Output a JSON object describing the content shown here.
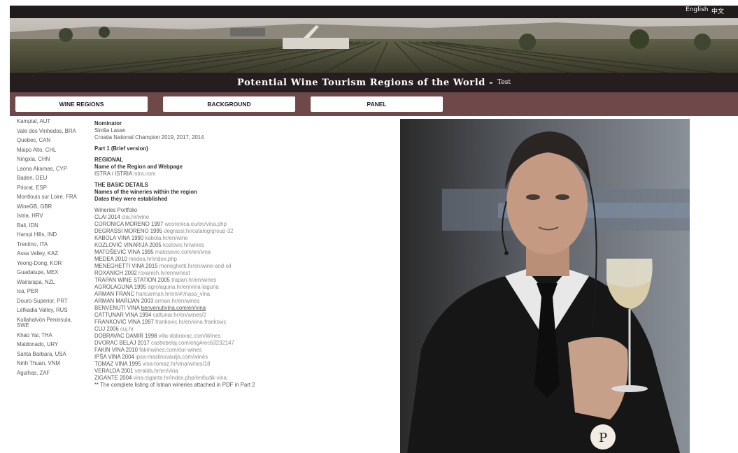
{
  "header": {
    "lang_english": "English",
    "lang_chinese": "中文",
    "title": "Potential Wine Tourism Regions of the World -",
    "subtitle": "Test"
  },
  "nav": {
    "wine_regions": "WINE REGIONS",
    "background": "BACKGROUND",
    "panel": "PANEL"
  },
  "sidebar": {
    "items": [
      "Kamptal, AUT",
      "Vale dos Vinhedos, BRA",
      "Quebec, CAN",
      "Maipo Alto, CHL",
      "Ningxia, CHN",
      "Laona Akamas, CYP",
      "Baden, DEU",
      "Priorat, ESP",
      "Montlouis sur Loire, FRA",
      "WineGB, GBR",
      "Istria, HRV",
      "Bali, IDN",
      "Hampi Hills, IND",
      "Trentino, ITA",
      "Assa Valley, KAZ",
      "Yeong-Dong, KOR",
      "Guadalupe, MEX",
      "Wairarapa, NZL",
      "Ica, PER",
      "Douro-Superior, PRT",
      "Lefkadia Valley, RUS",
      "Kullahalvön Peninsula, SWE",
      "Khao Yai, THA",
      "Maldonado, URY",
      "Santa Barbara, USA",
      "Ninh Thuan, VNM",
      "Agulhas, ZAF"
    ]
  },
  "content": {
    "nominator_label": "Nominator",
    "nominator_name": "Siniša Lasan",
    "nominator_title": "Croatia National Champion 2019, 2017, 2014",
    "part1": "Part 1 (Brief version)",
    "regional": "REGIONAL",
    "region_name_label": "Name of the Region and Webpage",
    "region_name": "ISTRA / ISTRIA",
    "region_url": "istra.com",
    "basic_details": "THE BASIC DETAILS",
    "wineries_label": "Names of the wineries within the region",
    "dates_label": "Dates they were established",
    "portfolio": "Wineries Portfolio",
    "wineries": [
      {
        "name": "CLAI 2014",
        "url": "clai.hr/wine"
      },
      {
        "name": "CORONICA MORENO 1997",
        "url": "wcoronica.eu/en/vina.php"
      },
      {
        "name": "DEGRASSI MORENO 1995",
        "url": "degrassi.hr/catalog/group-32"
      },
      {
        "name": "KABOLA VINA 1990",
        "url": "kabola.hr/en/wine"
      },
      {
        "name": "KOZLOVIĆ VINARIJA 2005",
        "url": "kozlovic.hr/wines"
      },
      {
        "name": "MATOŠEVIĆ VINA 1995",
        "url": "matosevic.com/en/vina"
      },
      {
        "name": "MEDEA 2010",
        "url": "medea.hr/index.php"
      },
      {
        "name": "MENEGHETTI VINA 2015",
        "url": "meneghetti.hr/en/wine-and-oil"
      },
      {
        "name": "ROXANICH 2002",
        "url": "roxanich.hr/en/winest"
      },
      {
        "name": "TRAPAN WINE STATION 2005",
        "url": "trapan.hr/en/wines"
      },
      {
        "name": "AGROLAGUNA 1995",
        "url": "agrolaguna.hr/en/vina-laguna"
      },
      {
        "name": "ARMAN FRANC",
        "url": "francarman.hr/en/#!/nasa_vina"
      },
      {
        "name": "ARMAN MARIJAN 2003",
        "url": "arman.hr/en/wines"
      },
      {
        "name": "BENVENUTI VINA",
        "url": "benvenutivina.com/en/vina"
      },
      {
        "name": "CATTUNAR VINA 1994",
        "url": "cattunar.hr/en/wines/2"
      },
      {
        "name": "FRANKOVIĆ VINA 1997",
        "url": "frankovic.hr/en/vina-frankovic"
      },
      {
        "name": "CUJ 2006",
        "url": "cuj.hr"
      },
      {
        "name": "DOBRAVAC DAMIR 1998",
        "url": "villa-dobravac.com/Wines"
      },
      {
        "name": "DVORAC BELAJ 2017",
        "url": "castlebelaj.com/eng#rec63232147"
      },
      {
        "name": "FAKIN VINA 2010",
        "url": "fakinwines.com/our-wines"
      },
      {
        "name": "IPŠA VINA 2004",
        "url": "ipsa-maslinovaulja.com/wines"
      },
      {
        "name": "TOMAZ VINA 1995",
        "url": "vina-tomaz.hr/vina/wines/18"
      },
      {
        "name": "VERALDA 2001",
        "url": "veralda.hr/en/vina"
      },
      {
        "name": "ZIGANTE 2004",
        "url": "vina-zigante.hr/index.php/en/butik-vina"
      }
    ],
    "footnote": "** The complete listing of Istrian wineries attached in PDF in Part 2"
  },
  "colors": {
    "top_bar": "#201c1b",
    "title_bar": "#261d1e",
    "nav_bar": "#6f4849",
    "button_bg": "#ffffff"
  },
  "icons": [
    "vineyard-banner-image",
    "sommelier-photo"
  ]
}
